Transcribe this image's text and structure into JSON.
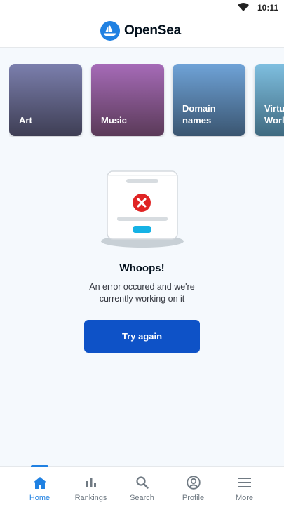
{
  "status_bar": {
    "time": "10:11",
    "icons": [
      "wifi-icon"
    ]
  },
  "header": {
    "brand_name": "OpenSea",
    "logo_icon": "opensea-logo-icon"
  },
  "categories": [
    {
      "label": "Art"
    },
    {
      "label": "Music"
    },
    {
      "label": "Domain\nnames"
    },
    {
      "label": "Virtual\nWorlds"
    }
  ],
  "error": {
    "illustration_icon": "error-card-icon",
    "title": "Whoops!",
    "message": "An error occured and we're currently working on it",
    "button_label": "Try again"
  },
  "bottom_nav": {
    "active": "Home",
    "items": [
      {
        "label": "Home",
        "icon": "home-icon"
      },
      {
        "label": "Rankings",
        "icon": "bar-chart-icon"
      },
      {
        "label": "Search",
        "icon": "search-icon"
      },
      {
        "label": "Profile",
        "icon": "profile-icon"
      },
      {
        "label": "More",
        "icon": "menu-icon"
      }
    ]
  },
  "colors": {
    "brand_blue": "#2081e2",
    "button_blue": "#0e52c7",
    "error_red": "#e02424",
    "accent_cyan": "#15b2e5",
    "background": "#f5f9fd"
  }
}
